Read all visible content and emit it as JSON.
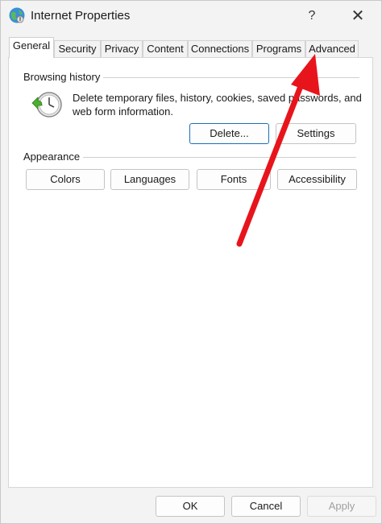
{
  "window": {
    "title": "Internet Properties",
    "help_label": "?",
    "close_label": "✕"
  },
  "tabs": [
    {
      "label": "General",
      "active": true
    },
    {
      "label": "Security"
    },
    {
      "label": "Privacy"
    },
    {
      "label": "Content"
    },
    {
      "label": "Connections"
    },
    {
      "label": "Programs"
    },
    {
      "label": "Advanced"
    }
  ],
  "browsing_history": {
    "heading": "Browsing history",
    "description": "Delete temporary files, history, cookies, saved passwords, and web form information.",
    "delete_label": "Delete...",
    "settings_label": "Settings"
  },
  "appearance": {
    "heading": "Appearance",
    "colors_label": "Colors",
    "languages_label": "Languages",
    "fonts_label": "Fonts",
    "accessibility_label": "Accessibility"
  },
  "footer": {
    "ok_label": "OK",
    "cancel_label": "Cancel",
    "apply_label": "Apply"
  },
  "colors": {
    "arrow": "#e8141c",
    "default_button_border": "#1a6fb5"
  }
}
